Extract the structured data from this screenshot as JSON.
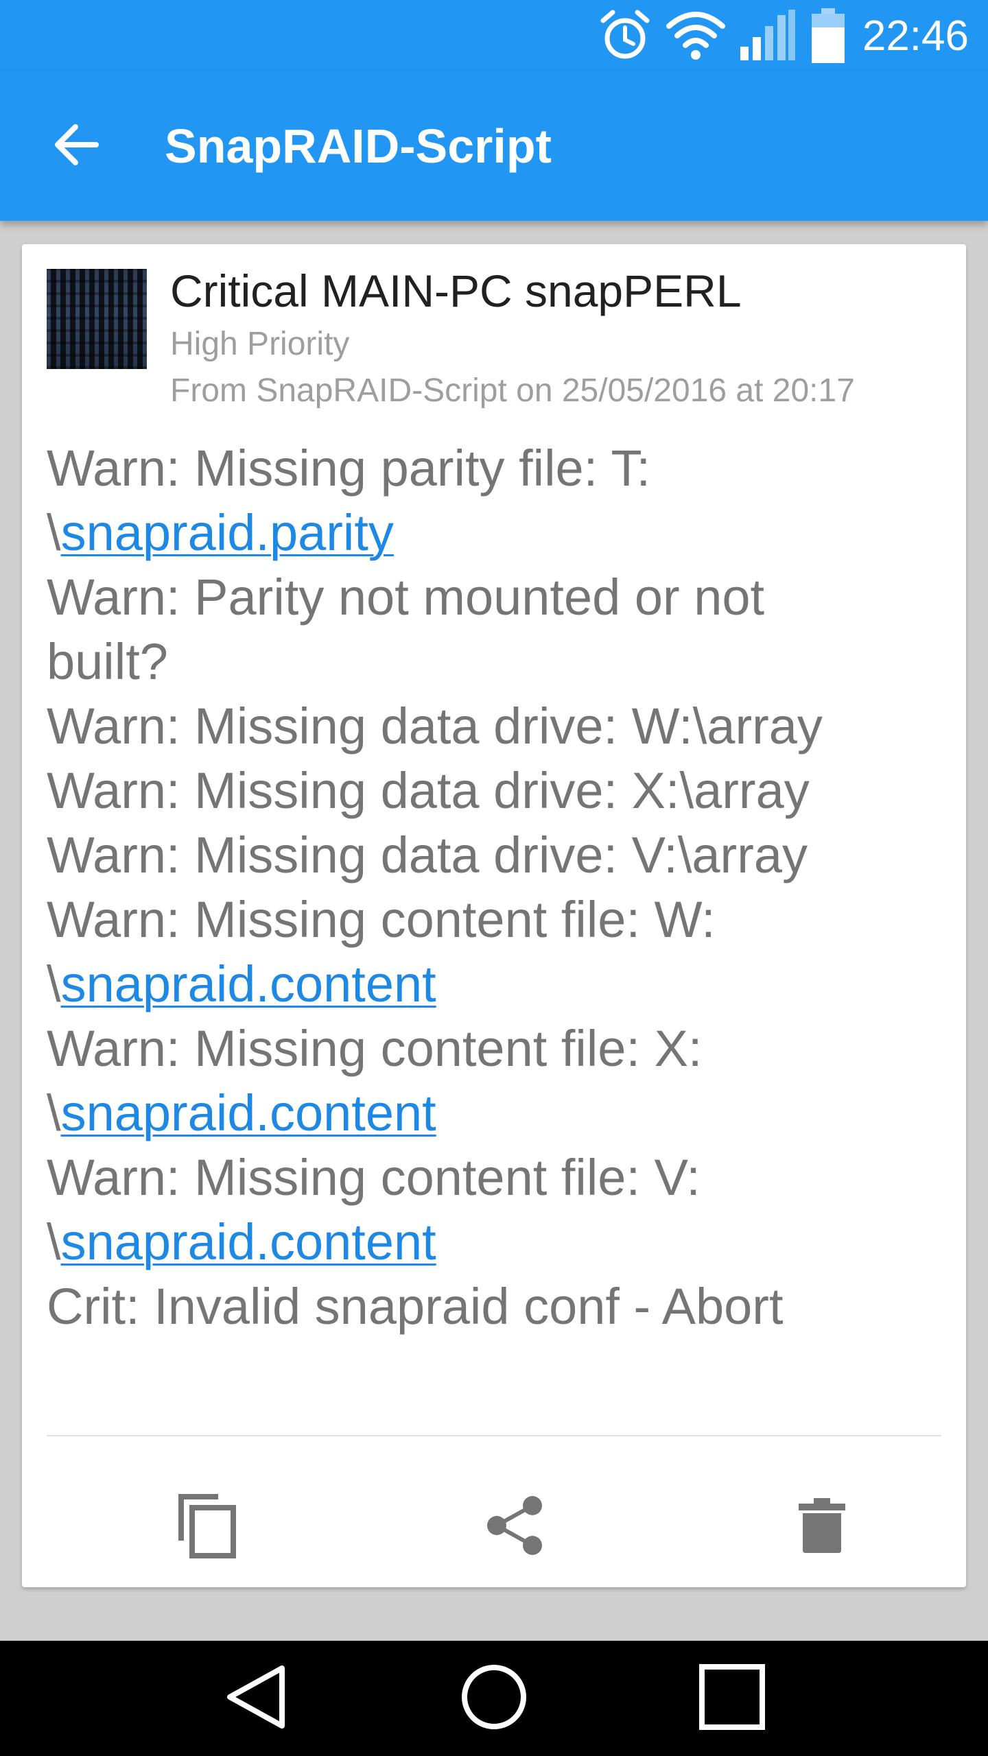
{
  "status_bar": {
    "time": "22:46",
    "icons": [
      "alarm-icon",
      "wifi-icon",
      "signal-icon",
      "battery-icon"
    ]
  },
  "toolbar": {
    "title": "SnapRAID-Script",
    "back_icon": "arrow-back-icon"
  },
  "message": {
    "title": "Critical MAIN-PC snapPERL",
    "priority": "High Priority",
    "from": "From SnapRAID-Script on 25/05/2016 at 20:17",
    "body_lines": [
      {
        "text": "Warn: Missing parity file: T:"
      },
      {
        "prefix": "\\",
        "link": "snapraid.parity"
      },
      {
        "text": "Warn: Parity not mounted or not"
      },
      {
        "text": "built?"
      },
      {
        "text": "Warn: Missing data drive: W:\\array"
      },
      {
        "text": "Warn: Missing data drive: X:\\array"
      },
      {
        "text": "Warn: Missing data drive: V:\\array"
      },
      {
        "text": "Warn: Missing content file: W:"
      },
      {
        "prefix": "\\",
        "link": "snapraid.content"
      },
      {
        "text": "Warn: Missing content file: X:"
      },
      {
        "prefix": "\\",
        "link": "snapraid.content"
      },
      {
        "text": "Warn: Missing content file: V:"
      },
      {
        "prefix": "\\",
        "link": "snapraid.content"
      },
      {
        "text": "Crit: Invalid snapraid conf - Abort"
      }
    ],
    "actions": [
      "copy-icon",
      "share-icon",
      "delete-icon"
    ]
  },
  "nav_bar": {
    "buttons": [
      "back-triangle-icon",
      "home-circle-icon",
      "recents-square-icon"
    ]
  },
  "colors": {
    "primary": "#2196f3",
    "link": "#1e88e5",
    "body_text": "#757575",
    "secondary_text": "#9e9e9e"
  }
}
